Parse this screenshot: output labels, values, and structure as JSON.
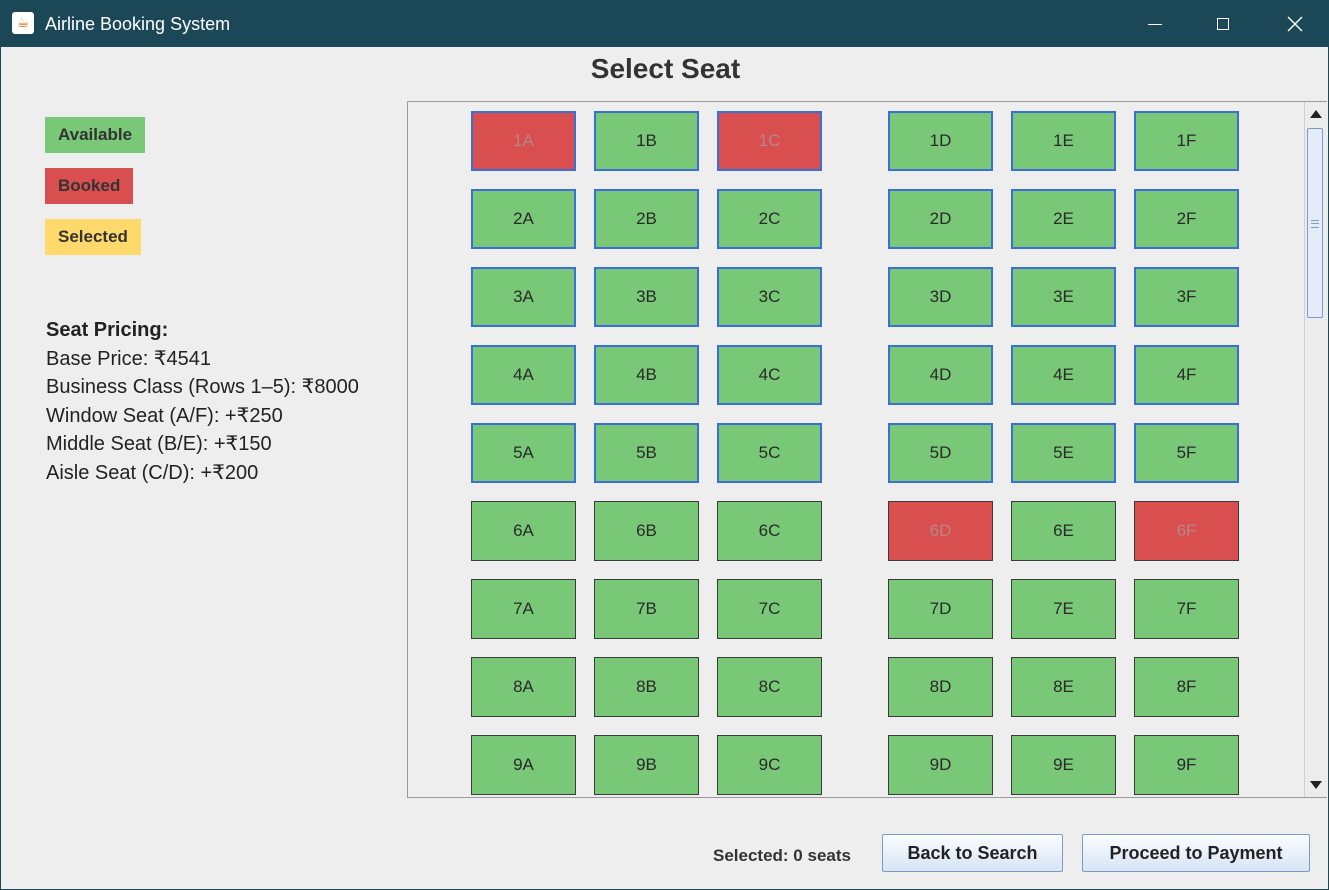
{
  "window": {
    "title": "Airline Booking System",
    "icon": "java-coffee-icon"
  },
  "page_title": "Select Seat",
  "legend": {
    "available": "Available",
    "booked": "Booked",
    "selected": "Selected"
  },
  "colors": {
    "available": "#78c878",
    "booked": "#d94f4f",
    "selected": "#ffd96b",
    "titlebar": "#1b4757",
    "focus_border": "#3a6fd8"
  },
  "pricing": {
    "heading": "Seat Pricing:",
    "lines": [
      "Base Price: ₹4541",
      "Business Class (Rows 1–5): ₹8000",
      "Window Seat (A/F): +₹250",
      "Middle Seat (B/E): +₹150",
      "Aisle Seat (C/D): +₹200"
    ]
  },
  "seat_map": {
    "visible_rows": [
      1,
      2,
      3,
      4,
      5,
      6,
      7,
      8,
      9
    ],
    "columns": [
      "A",
      "B",
      "C",
      "D",
      "E",
      "F"
    ],
    "booked": [
      "1A",
      "1C",
      "6D",
      "6F"
    ],
    "business_rows": [
      1,
      2,
      3,
      4,
      5
    ]
  },
  "footer": {
    "status": "Selected: 0 seats",
    "back_label": "Back to Search",
    "proceed_label": "Proceed to Payment"
  }
}
